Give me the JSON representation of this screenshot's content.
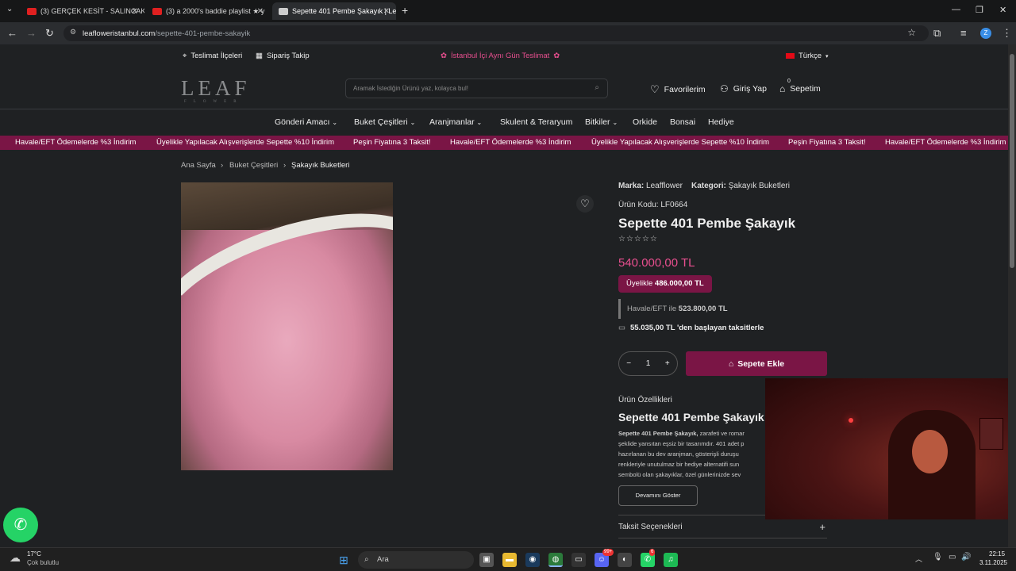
{
  "browser": {
    "tabs": [
      {
        "title": "(3) GERÇEK KESİT - SALINCAK -"
      },
      {
        "title": "(3) a 2000's baddie playlist ★ y"
      },
      {
        "title": "Sepette 401 Pembe Şakayık | Le"
      }
    ],
    "url_domain": "leafloweristanbul.com",
    "url_path": "/sepette-401-pembe-sakayik",
    "profile_letter": "Z"
  },
  "site": {
    "top": {
      "delivery_areas": "Teslimat İlçeleri",
      "order_tracking": "Sipariş Takip",
      "promo": "İstanbul İçi Aynı Gün Teslimat",
      "language": "Türkçe"
    },
    "logo": {
      "main": "LEAF",
      "sub": "FLOWER"
    },
    "search": {
      "placeholder": "Aramak İstediğin Ürünü yaz, kolayca bul!"
    },
    "header_links": {
      "favorites": "Favorilerim",
      "login": "Giriş Yap",
      "cart": "Sepetim",
      "cart_count": "0"
    },
    "menu": [
      "Gönderi Amacı",
      "Buket Çeşitleri",
      "Aranjmanlar",
      "Skulent & Teraryum",
      "Bitkiler",
      "Orkide",
      "Bonsai",
      "Hediye"
    ],
    "ticker": [
      "Havale/EFT Ödemelerde %3 İndirim",
      "Üyelikle Yapılacak Alışverişlerde Sepette %10 İndirim",
      "Peşin Fiyatına 3 Taksit!",
      "Havale/EFT Ödemelerde %3 İndirim",
      "Üyelikle Yapılacak Alışverişlerde Sepette %10 İndirim",
      "Peşin Fiyatına 3 Taksit!",
      "Havale/EFT Ödemelerde %3 İndirim"
    ],
    "breadcrumb": [
      "Ana Sayfa",
      "Buket Çeşitleri",
      "Şakayık Buketleri"
    ],
    "product": {
      "brand_label": "Marka:",
      "brand": "Leafflower",
      "category_label": "Kategori:",
      "category": "Şakayık Buketleri",
      "code_label": "Ürün Kodu:",
      "code": "LF0664",
      "title": "Sepette 401 Pembe Şakayık",
      "stars": "☆☆☆☆☆",
      "price": "540.000,00 TL",
      "member_label": "Üyelikle",
      "member_price": "486.000,00 TL",
      "eft_label": "Havale/EFT ile",
      "eft_price": "523.800,00 TL",
      "installment_text": "55.035,00 TL 'den başlayan taksitlerle",
      "quantity": "1",
      "add_to_cart": "Sepete Ekle",
      "features_label": "Ürün Özellikleri",
      "features_title": "Sepette 401 Pembe Şakayık H",
      "desc_bold": "Sepette 401 Pembe Şakayık,",
      "desc_1": " zarafeti ve romar",
      "desc_2": "şeklide yansıtan eşsiz bir tasarımdır. 401 adet p",
      "desc_3": "hazırlanan bu dev aranjman, gösterişli duruşu",
      "desc_4": "renkleriyle unutulmaz bir hediye alternatifi sun",
      "desc_5": "sembolü olan şakayıklar, özel günlerinizde sev",
      "show_more": "Devamını Göster",
      "installment_options": "Taksit Seçenekleri"
    }
  },
  "taskbar": {
    "weather_temp": "17°C",
    "weather_desc": "Çok bulutlu",
    "search_label": "Ara",
    "time": "22:15",
    "date": "3.11.2025",
    "discord_badge": "99+",
    "whatsapp_badge": "6"
  },
  "colors": {
    "accent": "#7a1545",
    "price": "#e84f8f",
    "whatsapp": "#25d366"
  }
}
